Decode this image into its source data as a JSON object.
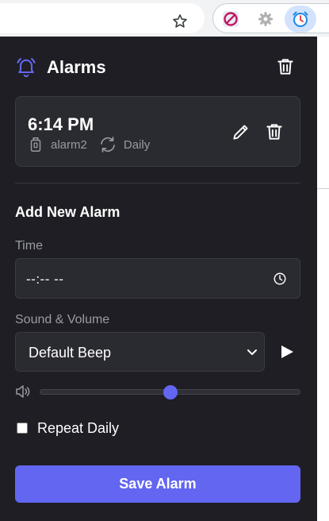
{
  "browser": {
    "toolbar_icons": [
      "star-icon",
      "blocked-extension-icon",
      "gear-extension-icon",
      "alarm-clock-extension-icon"
    ]
  },
  "popup": {
    "title": "Alarms",
    "accent": "#6366f1",
    "background": "#1e1e24",
    "alarms": [
      {
        "time": "6:14 PM",
        "name": "alarm2",
        "repeat": "Daily"
      }
    ],
    "new_alarm": {
      "section_title": "Add New Alarm",
      "time_label": "Time",
      "time_value": "--:-- --",
      "sound_label": "Sound & Volume",
      "sound_selected": "Default Beep",
      "volume_fraction": 0.5,
      "repeat_label": "Repeat Daily",
      "repeat_checked": false,
      "save_label": "Save Alarm"
    }
  }
}
